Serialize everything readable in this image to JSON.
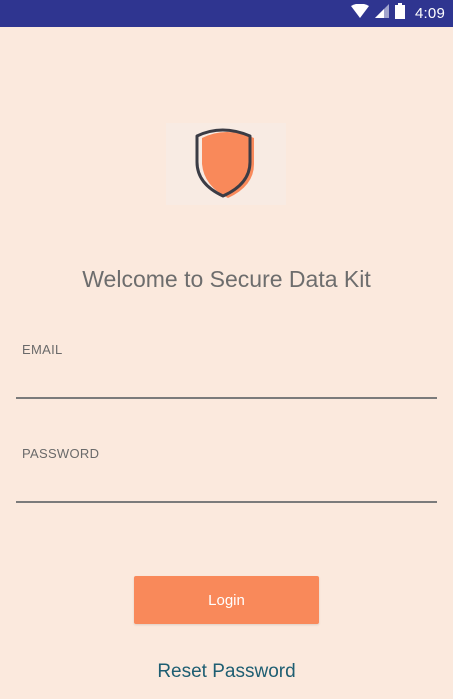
{
  "status_bar": {
    "time": "4:09",
    "icons": [
      "wifi-icon",
      "cell-signal-icon",
      "battery-icon"
    ],
    "background": "#2f3590"
  },
  "logo": {
    "icon": "shield-icon",
    "accent": "#f9895a"
  },
  "welcome": {
    "title": "Welcome to Secure Data Kit"
  },
  "form": {
    "email": {
      "label": "EMAIL",
      "value": "",
      "placeholder": ""
    },
    "password": {
      "label": "PASSWORD",
      "value": "",
      "placeholder": ""
    }
  },
  "actions": {
    "login_label": "Login",
    "reset_label": "Reset Password"
  },
  "colors": {
    "background": "#fbe9dd",
    "button": "#f9895a",
    "link": "#1e5e72"
  }
}
